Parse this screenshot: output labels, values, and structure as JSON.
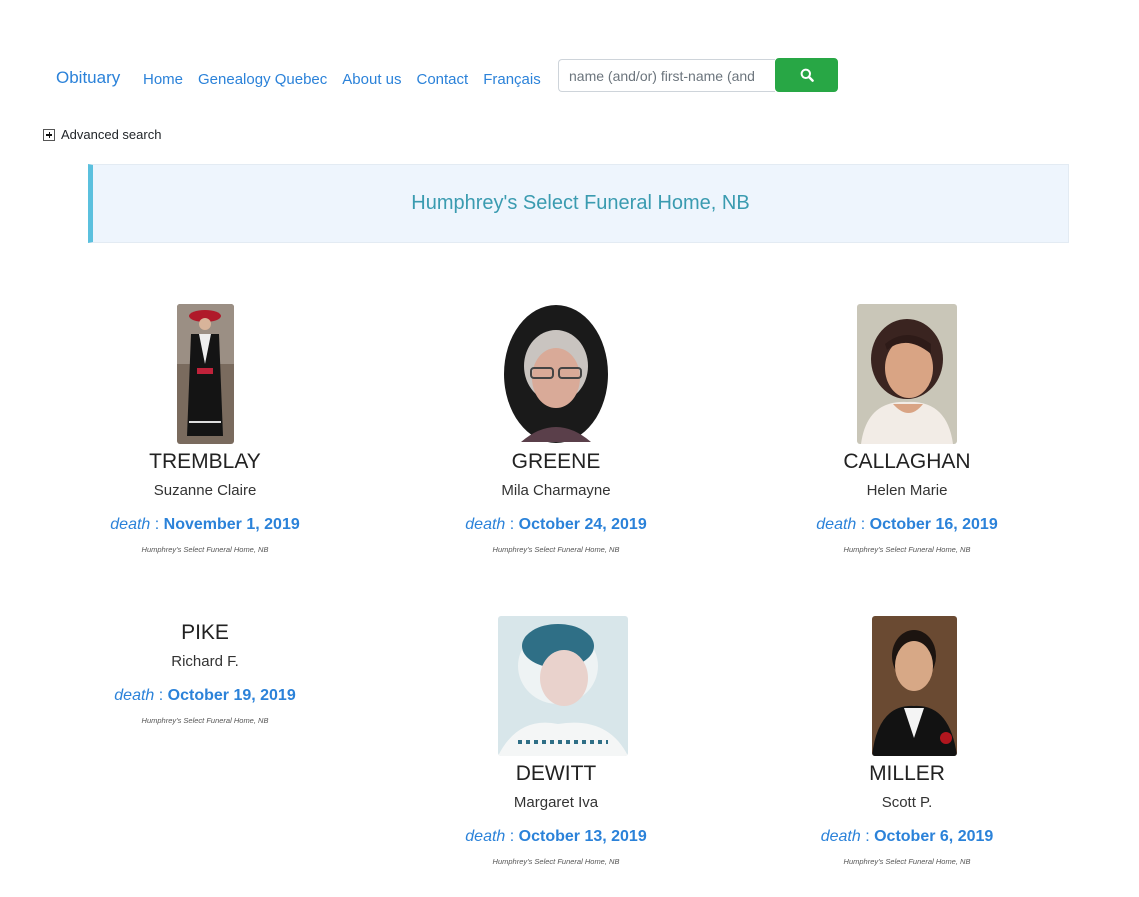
{
  "nav": {
    "brand": "Obituary",
    "links": [
      "Home",
      "Genealogy Quebec",
      "About us",
      "Contact",
      "Français"
    ]
  },
  "search": {
    "placeholder": "name (and/or) first-name (and",
    "button_icon": "search-icon",
    "button_color": "#28a745"
  },
  "advanced_search": {
    "label": "Advanced search",
    "icon": "plus-square-icon"
  },
  "banner": {
    "title": "Humphrey's Select Funeral Home, NB"
  },
  "death_label": "death",
  "colors": {
    "link": "#2b82d9",
    "banner_accent": "#5bc0de",
    "banner_text": "#3a9bb0"
  },
  "obituaries": [
    {
      "surname": "TREMBLAY",
      "given": "Suzanne Claire",
      "death_date": "November 1, 2019",
      "home": "Humphrey's Select Funeral Home, NB",
      "has_photo": true
    },
    {
      "surname": "GREENE",
      "given": "Mila Charmayne",
      "death_date": "October 24, 2019",
      "home": "Humphrey's Select Funeral Home, NB",
      "has_photo": true
    },
    {
      "surname": "CALLAGHAN",
      "given": "Helen Marie",
      "death_date": "October 16, 2019",
      "home": "Humphrey's Select Funeral Home, NB",
      "has_photo": true
    },
    {
      "surname": "PIKE",
      "given": "Richard F.",
      "death_date": "October 19, 2019",
      "home": "Humphrey's Select Funeral Home, NB",
      "has_photo": false
    },
    {
      "surname": "DEWITT",
      "given": "Margaret Iva",
      "death_date": "October 13, 2019",
      "home": "Humphrey's Select Funeral Home, NB",
      "has_photo": true
    },
    {
      "surname": "MILLER",
      "given": "Scott P.",
      "death_date": "October 6, 2019",
      "home": "Humphrey's Select Funeral Home, NB",
      "has_photo": true
    }
  ]
}
